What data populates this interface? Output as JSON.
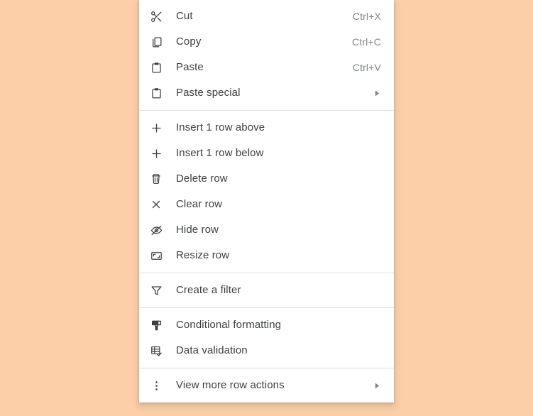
{
  "theme": {
    "page_background": "#fccfa8",
    "menu_background": "#ffffff",
    "label_color": "#3c4043",
    "shortcut_color": "#80868b",
    "divider_color": "#e0e0e0"
  },
  "context_menu": {
    "groups": [
      {
        "id": "clipboard",
        "items": [
          {
            "label": "Cut",
            "shortcut": "Ctrl+X",
            "icon": "scissors-icon",
            "submenu": false
          },
          {
            "label": "Copy",
            "shortcut": "Ctrl+C",
            "icon": "copy-icon",
            "submenu": false
          },
          {
            "label": "Paste",
            "shortcut": "Ctrl+V",
            "icon": "clipboard-icon",
            "submenu": false
          },
          {
            "label": "Paste special",
            "shortcut": "",
            "icon": "clipboard-icon",
            "submenu": true
          }
        ]
      },
      {
        "id": "row-actions",
        "items": [
          {
            "label": "Insert 1 row above",
            "shortcut": "",
            "icon": "plus-icon",
            "submenu": false
          },
          {
            "label": "Insert 1 row below",
            "shortcut": "",
            "icon": "plus-icon",
            "submenu": false
          },
          {
            "label": "Delete row",
            "shortcut": "",
            "icon": "trash-icon",
            "submenu": false
          },
          {
            "label": "Clear row",
            "shortcut": "",
            "icon": "close-icon",
            "submenu": false
          },
          {
            "label": "Hide row",
            "shortcut": "",
            "icon": "eye-off-icon",
            "submenu": false
          },
          {
            "label": "Resize row",
            "shortcut": "",
            "icon": "resize-icon",
            "submenu": false
          }
        ]
      },
      {
        "id": "filter",
        "items": [
          {
            "label": "Create a filter",
            "shortcut": "",
            "icon": "filter-icon",
            "submenu": false
          }
        ]
      },
      {
        "id": "formatting",
        "items": [
          {
            "label": "Conditional formatting",
            "shortcut": "",
            "icon": "paint-roller-icon",
            "submenu": false
          },
          {
            "label": "Data validation",
            "shortcut": "",
            "icon": "table-check-icon",
            "submenu": false
          }
        ]
      },
      {
        "id": "more",
        "items": [
          {
            "label": "View more row actions",
            "shortcut": "",
            "icon": "more-vert-icon",
            "submenu": true
          }
        ]
      }
    ]
  }
}
